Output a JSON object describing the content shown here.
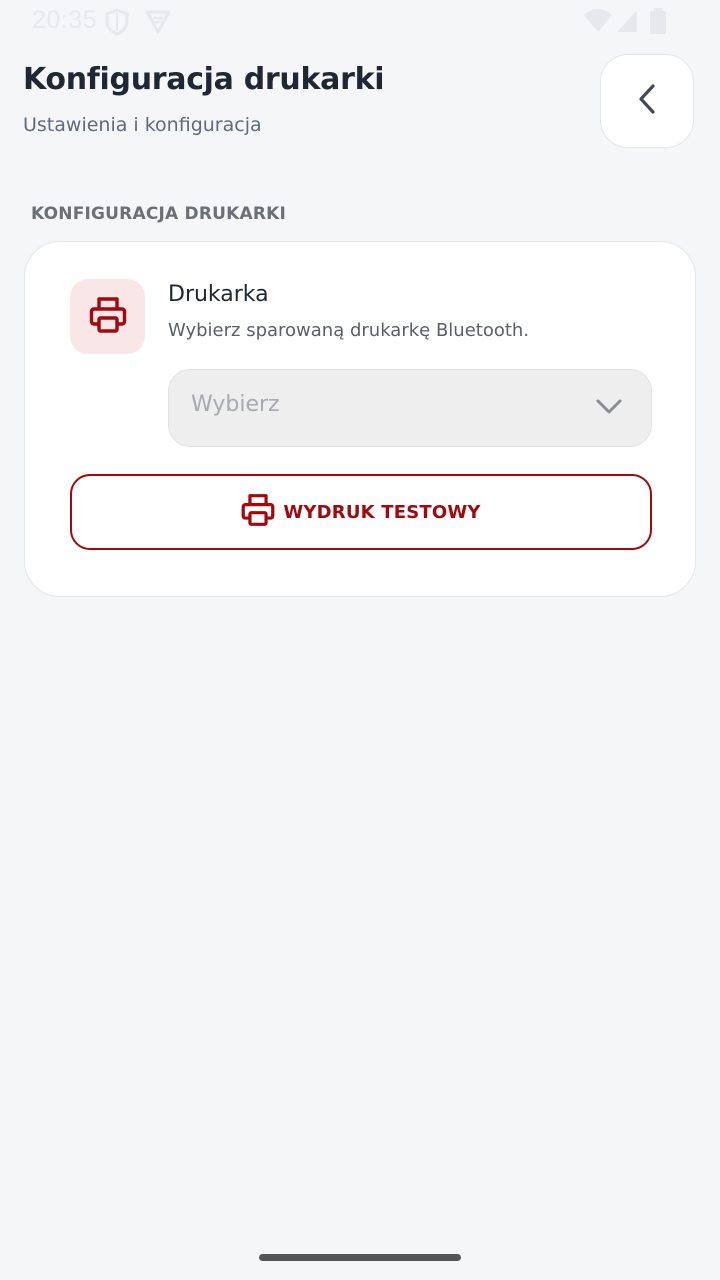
{
  "status_bar": {
    "time": "20:35",
    "icons": [
      "shield-icon",
      "vpn-icon",
      "wifi-icon",
      "signal-icon",
      "battery-icon"
    ]
  },
  "header": {
    "title": "Konfiguracja drukarki",
    "subtitle": "Ustawienia i konfiguracja",
    "back_icon": "chevron-left-icon"
  },
  "section": {
    "label": "KONFIGURACJA DRUKARKI"
  },
  "printer_card": {
    "icon": "printer-icon",
    "title": "Drukarka",
    "description": "Wybierz sparowaną drukarkę Bluetooth.",
    "select": {
      "placeholder": "Wybierz",
      "icon": "chevron-down-icon"
    },
    "test_button": {
      "label": "WYDRUK TESTOWY",
      "icon": "printer-icon"
    }
  },
  "colors": {
    "accent": "#a3080c",
    "accent_bg": "#f9e6e6",
    "background": "#f5f6f8",
    "title": "#1f2733"
  }
}
